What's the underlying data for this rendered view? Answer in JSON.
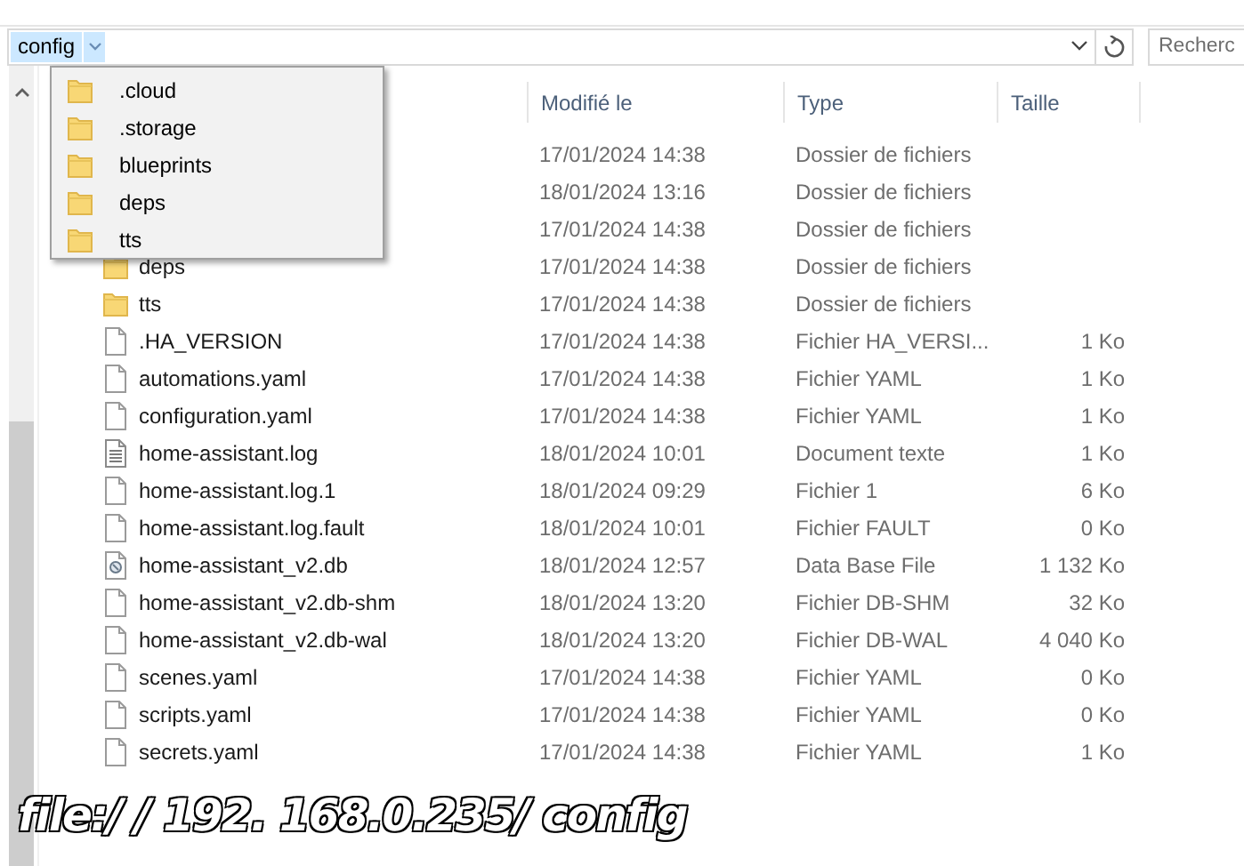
{
  "address_bar": {
    "breadcrumb": "config",
    "search": {
      "placeholder": "Recherc"
    }
  },
  "dropdown": [
    {
      "label": ".cloud",
      "kind": "folder"
    },
    {
      "label": ".storage",
      "kind": "folder"
    },
    {
      "label": "blueprints",
      "kind": "folder"
    },
    {
      "label": "deps",
      "kind": "folder"
    },
    {
      "label": "tts",
      "kind": "folder"
    }
  ],
  "columns": [
    "Modifié le",
    "Type",
    "Taille"
  ],
  "rows": [
    {
      "modified": "17/01/2024 14:38",
      "type": "Dossier de fichiers"
    },
    {
      "modified": "18/01/2024 13:16",
      "type": "Dossier de fichiers"
    },
    {
      "modified": "17/01/2024 14:38",
      "type": "Dossier de fichiers"
    },
    {
      "kind": "folder",
      "name": "deps",
      "modified": "17/01/2024 14:38",
      "type": "Dossier de fichiers"
    },
    {
      "kind": "folder",
      "name": "tts",
      "modified": "17/01/2024 14:38",
      "type": "Dossier de fichiers"
    },
    {
      "kind": "file",
      "name": ".HA_VERSION",
      "modified": "17/01/2024 14:38",
      "type": "Fichier HA_VERSI...",
      "size": "1 Ko"
    },
    {
      "kind": "file",
      "name": "automations.yaml",
      "modified": "17/01/2024 14:38",
      "type": "Fichier YAML",
      "size": "1 Ko"
    },
    {
      "kind": "file",
      "name": "configuration.yaml",
      "modified": "17/01/2024 14:38",
      "type": "Fichier YAML",
      "size": "1 Ko"
    },
    {
      "kind": "text",
      "name": "home-assistant.log",
      "modified": "18/01/2024 10:01",
      "type": "Document texte",
      "size": "1 Ko"
    },
    {
      "kind": "file",
      "name": "home-assistant.log.1",
      "modified": "18/01/2024 09:29",
      "type": "Fichier 1",
      "size": "6 Ko"
    },
    {
      "kind": "file",
      "name": "home-assistant.log.fault",
      "modified": "18/01/2024 10:01",
      "type": "Fichier FAULT",
      "size": "0 Ko"
    },
    {
      "kind": "database",
      "name": "home-assistant_v2.db",
      "modified": "18/01/2024 12:57",
      "type": "Data Base File",
      "size": "1 132 Ko"
    },
    {
      "kind": "file",
      "name": "home-assistant_v2.db-shm",
      "modified": "18/01/2024 13:20",
      "type": "Fichier DB-SHM",
      "size": "32 Ko"
    },
    {
      "kind": "file",
      "name": "home-assistant_v2.db-wal",
      "modified": "18/01/2024 13:20",
      "type": "Fichier DB-WAL",
      "size": "4 040 Ko"
    },
    {
      "kind": "file",
      "name": "scenes.yaml",
      "modified": "17/01/2024 14:38",
      "type": "Fichier YAML",
      "size": "0 Ko"
    },
    {
      "kind": "file",
      "name": "scripts.yaml",
      "modified": "17/01/2024 14:38",
      "type": "Fichier YAML",
      "size": "0 Ko"
    },
    {
      "kind": "file",
      "name": "secrets.yaml",
      "modified": "17/01/2024 14:38",
      "type": "Fichier YAML",
      "size": "1 Ko"
    }
  ],
  "annotation": "file:/ / 192. 168.0.235/ config"
}
